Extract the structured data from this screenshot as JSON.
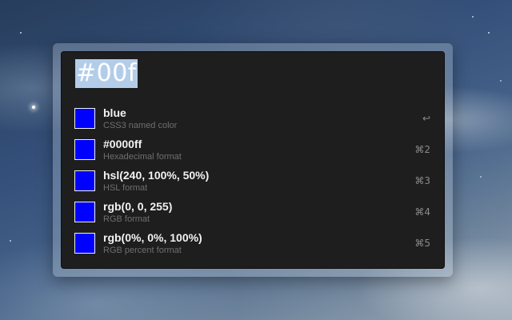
{
  "colors": {
    "swatch": "#0000ff",
    "query_highlight": "#b3cde9",
    "panel_background": "#1e1e1f",
    "subtitle_text": "#6f6f72"
  },
  "search": {
    "query": "#00f"
  },
  "results": [
    {
      "title": "blue",
      "subtitle": "CSS3 named color",
      "shortcut": "↩",
      "swatch_color": "#0000ff",
      "icon": "color-swatch-icon"
    },
    {
      "title": "#0000ff",
      "subtitle": "Hexadecimal format",
      "shortcut": "⌘2",
      "swatch_color": "#0000ff",
      "icon": "color-swatch-icon"
    },
    {
      "title": "hsl(240, 100%, 50%)",
      "subtitle": "HSL format",
      "shortcut": "⌘3",
      "swatch_color": "#0000ff",
      "icon": "color-swatch-icon"
    },
    {
      "title": "rgb(0, 0, 255)",
      "subtitle": "RGB format",
      "shortcut": "⌘4",
      "swatch_color": "#0000ff",
      "icon": "color-swatch-icon"
    },
    {
      "title": "rgb(0%, 0%, 100%)",
      "subtitle": "RGB percent format",
      "shortcut": "⌘5",
      "swatch_color": "#0000ff",
      "icon": "color-swatch-icon"
    }
  ]
}
